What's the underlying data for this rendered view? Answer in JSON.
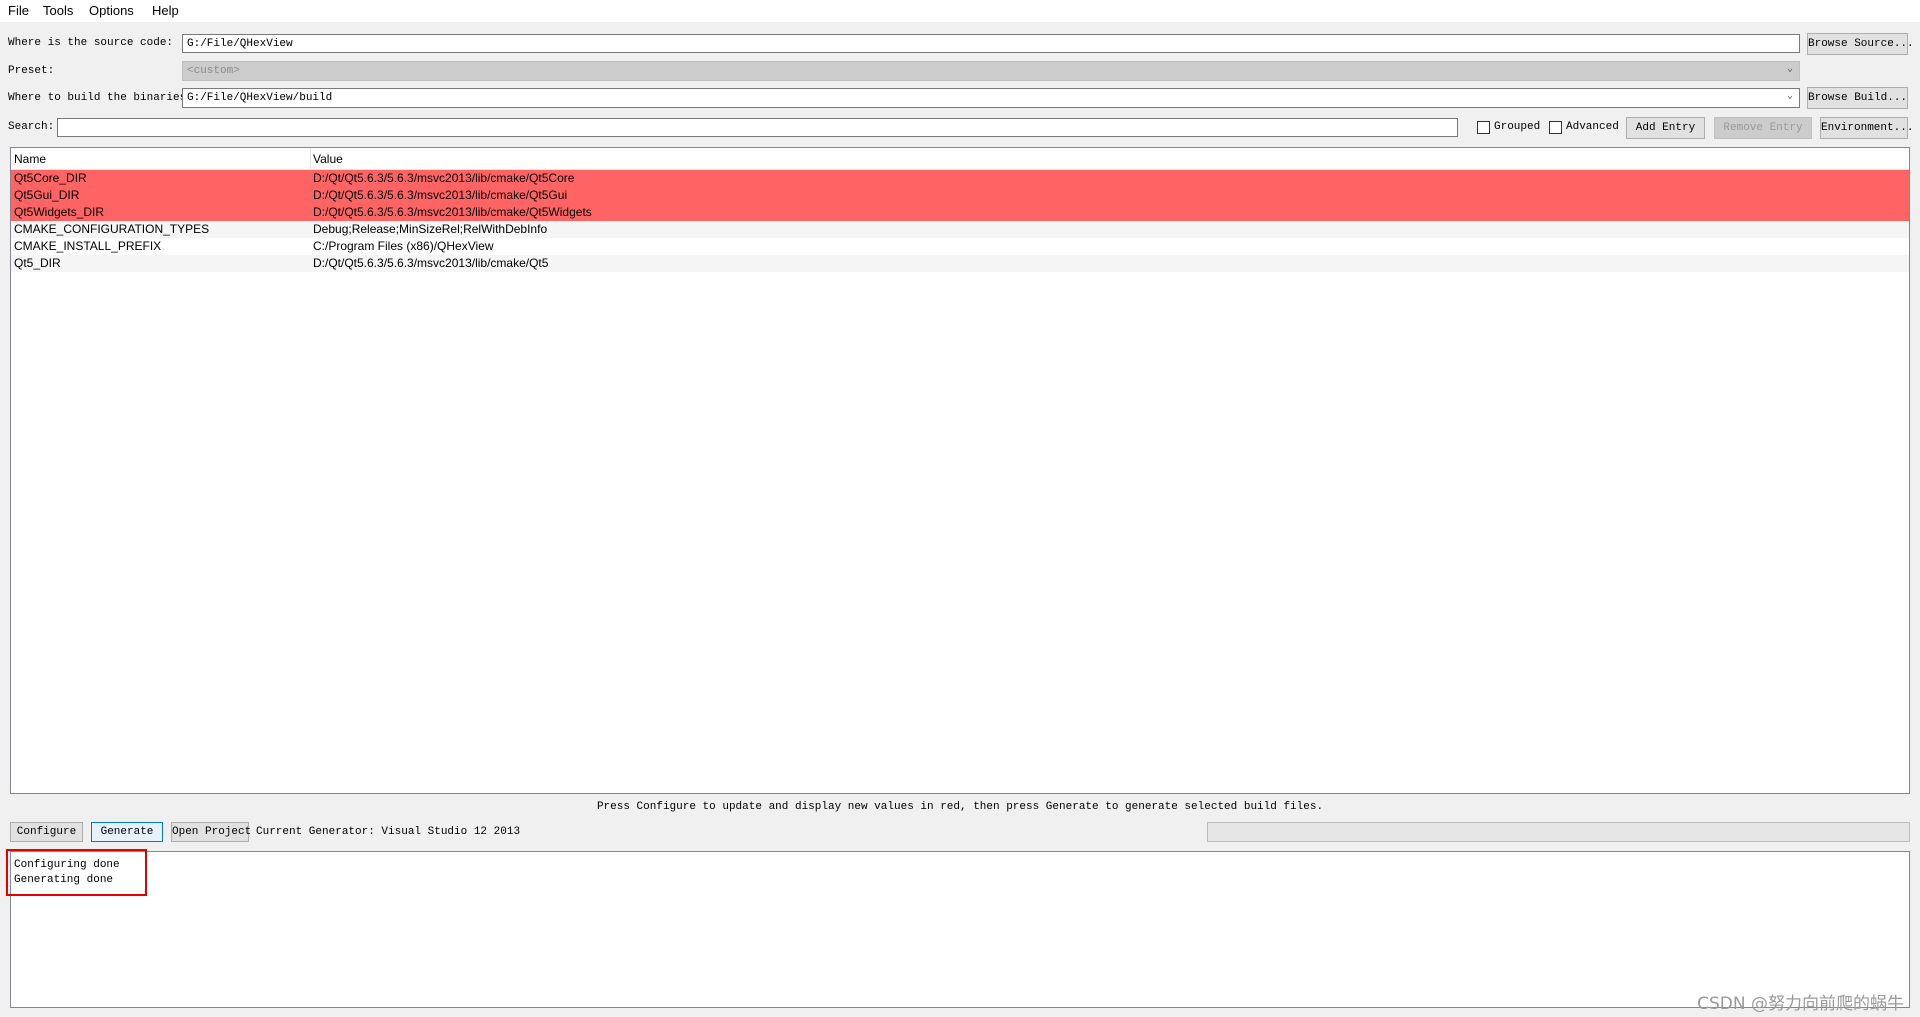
{
  "menu": [
    "File",
    "Tools",
    "Options",
    "Help"
  ],
  "source": {
    "label": "Where is the source code:",
    "value": "G:/File/QHexView",
    "browse_label": "Browse Source..."
  },
  "preset": {
    "label": "Preset:",
    "value": "<custom>"
  },
  "build": {
    "label": "Where to build the binaries:",
    "value": "G:/File/QHexView/build",
    "browse_label": "Browse Build..."
  },
  "search": {
    "label": "Search:",
    "value": ""
  },
  "options": {
    "grouped_label": "Grouped",
    "grouped_checked": false,
    "advanced_label": "Advanced",
    "advanced_checked": false
  },
  "toolbar": {
    "add_entry": "Add Entry",
    "remove_entry": "Remove Entry",
    "environment": "Environment..."
  },
  "table": {
    "headers": [
      "Name",
      "Value"
    ],
    "rows": [
      {
        "name": "Qt5Core_DIR",
        "value": "D:/Qt/Qt5.6.3/5.6.3/msvc2013/lib/cmake/Qt5Core",
        "new": true
      },
      {
        "name": "Qt5Gui_DIR",
        "value": "D:/Qt/Qt5.6.3/5.6.3/msvc2013/lib/cmake/Qt5Gui",
        "new": true
      },
      {
        "name": "Qt5Widgets_DIR",
        "value": "D:/Qt/Qt5.6.3/5.6.3/msvc2013/lib/cmake/Qt5Widgets",
        "new": true
      },
      {
        "name": "CMAKE_CONFIGURATION_TYPES",
        "value": "Debug;Release;MinSizeRel;RelWithDebInfo",
        "new": false
      },
      {
        "name": "CMAKE_INSTALL_PREFIX",
        "value": "C:/Program Files (x86)/QHexView",
        "new": false
      },
      {
        "name": "Qt5_DIR",
        "value": "D:/Qt/Qt5.6.3/5.6.3/msvc2013/lib/cmake/Qt5",
        "new": false
      }
    ]
  },
  "hint": "Press Configure to update and display new values in red, then press Generate to generate selected build files.",
  "actions": {
    "configure": "Configure",
    "generate": "Generate",
    "open_project": "Open Project",
    "current_generator": "Current Generator: Visual Studio 12 2013"
  },
  "progress": 0,
  "output": [
    "Configuring done",
    "Generating done"
  ],
  "watermark": "CSDN @努力向前爬的蜗牛",
  "colors": {
    "new_entry": "#ff6464",
    "highlight_box": "#e60000",
    "focus": "#0078d7"
  }
}
